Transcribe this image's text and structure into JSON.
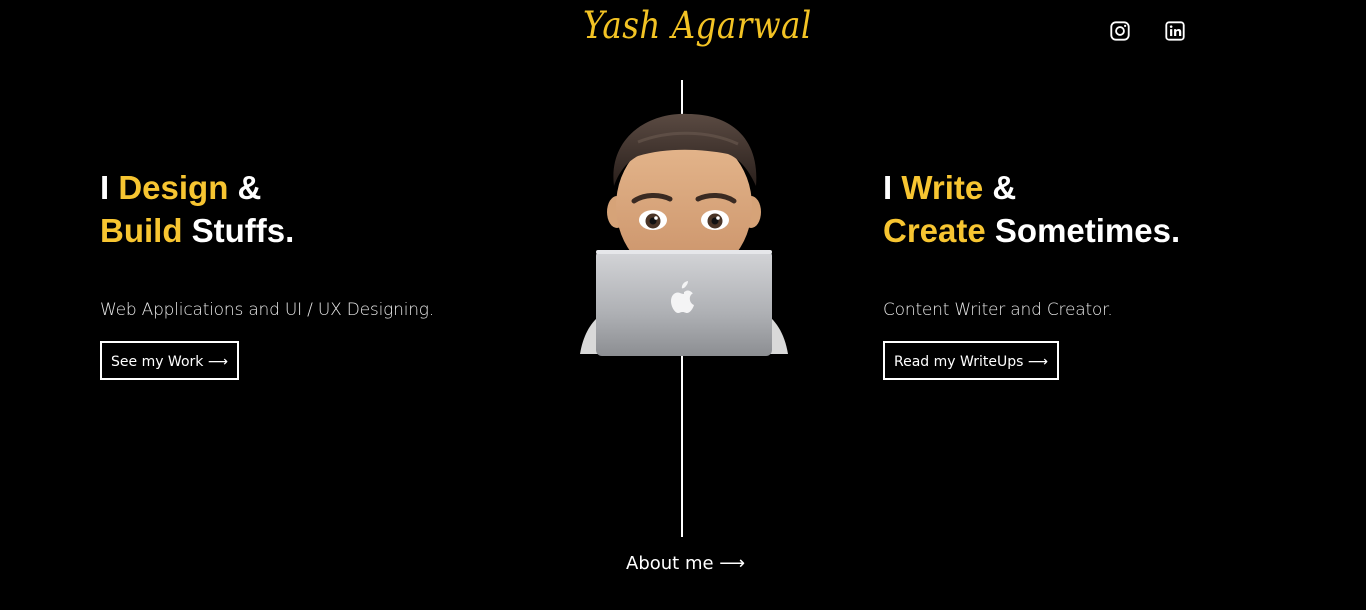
{
  "header": {
    "logo_text": "Yash Agarwal",
    "social": [
      {
        "name": "instagram-icon"
      },
      {
        "name": "linkedin-icon"
      }
    ]
  },
  "left": {
    "headline_line1_a": "I ",
    "headline_line1_b": "Design",
    "headline_line1_c": " &",
    "headline_line2_a": "Build",
    "headline_line2_b": " Stuffs.",
    "subtitle": "Web Applications and UI / UX Designing.",
    "button_label": "See my Work ⟶"
  },
  "right": {
    "headline_line1_a": "I ",
    "headline_line1_b": "Write",
    "headline_line1_c": " &",
    "headline_line2_a": "Create",
    "headline_line2_b": " Sometimes.",
    "subtitle": "Content Writer and Creator.",
    "button_label": "Read my WriteUps ⟶"
  },
  "footer": {
    "about_label": "About me ⟶"
  },
  "colors": {
    "background": "#000000",
    "accent": "#f7c531",
    "text": "#ffffff"
  }
}
